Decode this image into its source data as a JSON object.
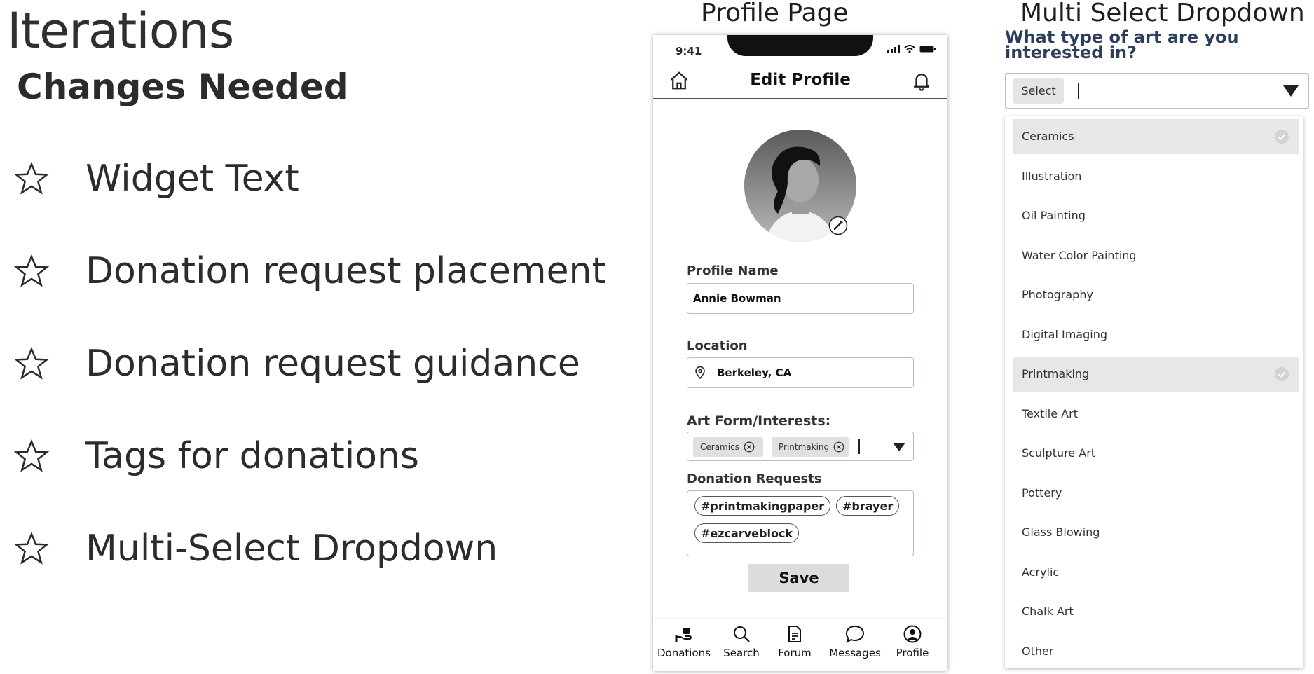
{
  "slide": {
    "title": "Iterations",
    "subtitle": "Changes Needed",
    "bullets": [
      "Widget Text",
      "Donation request placement",
      "Donation request guidance",
      "Tags for donations",
      "Multi-Select Dropdown"
    ]
  },
  "profile_section_title": "Profile Page",
  "dropdown_section_title": "Multi Select Dropdown",
  "phone": {
    "time": "9:41",
    "header_title": "Edit Profile",
    "profile_name_label": "Profile Name",
    "profile_name_value": "Annie Bowman",
    "location_label": "Location",
    "location_value": "Berkeley, CA",
    "art_label": "Art Form/Interests:",
    "art_chips": [
      "Ceramics",
      "Printmaking"
    ],
    "donation_label": "Donation Requests",
    "donation_tags": [
      "#printmakingpaper",
      "#brayer",
      "#ezcarveblock"
    ],
    "save_label": "Save",
    "tabs": [
      "Donations",
      "Search",
      "Forum",
      "Messages",
      "Profile"
    ]
  },
  "multi_select": {
    "question": "What type of art are you interested in?",
    "select_chip": "Select",
    "options": [
      {
        "label": "Ceramics",
        "selected": true
      },
      {
        "label": "Illustration",
        "selected": false
      },
      {
        "label": "Oil Painting",
        "selected": false
      },
      {
        "label": "Water Color Painting",
        "selected": false
      },
      {
        "label": "Photography",
        "selected": false
      },
      {
        "label": "Digital Imaging",
        "selected": false
      },
      {
        "label": "Printmaking",
        "selected": true
      },
      {
        "label": "Textile Art",
        "selected": false
      },
      {
        "label": "Sculpture Art",
        "selected": false
      },
      {
        "label": "Pottery",
        "selected": false
      },
      {
        "label": "Glass Blowing",
        "selected": false
      },
      {
        "label": "Acrylic",
        "selected": false
      },
      {
        "label": "Chalk Art",
        "selected": false
      },
      {
        "label": "Other",
        "selected": false
      }
    ]
  },
  "icons": {
    "bullet": "star-outline-icon",
    "home": "home-icon",
    "bell": "bell-icon",
    "location": "location-pin-icon",
    "dropdown": "triangle-down-icon",
    "chip_remove": "circle-x-icon",
    "selected": "check-circle-icon"
  }
}
